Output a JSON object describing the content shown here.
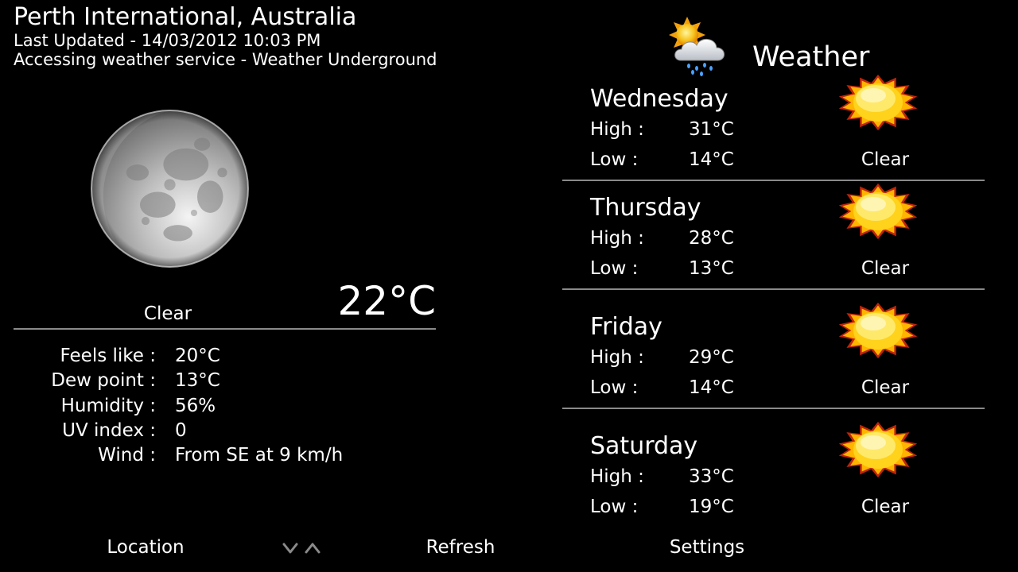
{
  "header": {
    "location": "Perth International, Australia",
    "last_updated": "Last Updated - 14/03/2012 10:03 PM",
    "service_status": "Accessing weather service - Weather Underground"
  },
  "current": {
    "icon": "moon-icon",
    "condition": "Clear",
    "temperature": "22°C",
    "details": [
      {
        "label": "Feels like :",
        "value": "20°C"
      },
      {
        "label": "Dew point :",
        "value": "13°C"
      },
      {
        "label": "Humidity :",
        "value": "56%"
      },
      {
        "label": "UV index :",
        "value": "0"
      },
      {
        "label": "Wind :",
        "value": "From SE at 9 km/h"
      }
    ]
  },
  "app": {
    "title": "Weather",
    "icon": "sun-cloud-rain-icon"
  },
  "forecast": [
    {
      "day": "Wednesday",
      "high_label": "High :",
      "high": "31°C",
      "low_label": "Low :",
      "low": "14°C",
      "condition": "Clear",
      "icon": "sun-icon"
    },
    {
      "day": "Thursday",
      "high_label": "High :",
      "high": "28°C",
      "low_label": "Low :",
      "low": "13°C",
      "condition": "Clear",
      "icon": "sun-icon"
    },
    {
      "day": "Friday",
      "high_label": "High :",
      "high": "29°C",
      "low_label": "Low :",
      "low": "14°C",
      "condition": "Clear",
      "icon": "sun-icon"
    },
    {
      "day": "Saturday",
      "high_label": "High :",
      "high": "33°C",
      "low_label": "Low :",
      "low": "19°C",
      "condition": "Clear",
      "icon": "sun-icon"
    }
  ],
  "bottom_bar": {
    "location_label": "Location",
    "refresh_label": "Refresh",
    "settings_label": "Settings",
    "chevrons_icon": "chevron-down-up-icon"
  }
}
